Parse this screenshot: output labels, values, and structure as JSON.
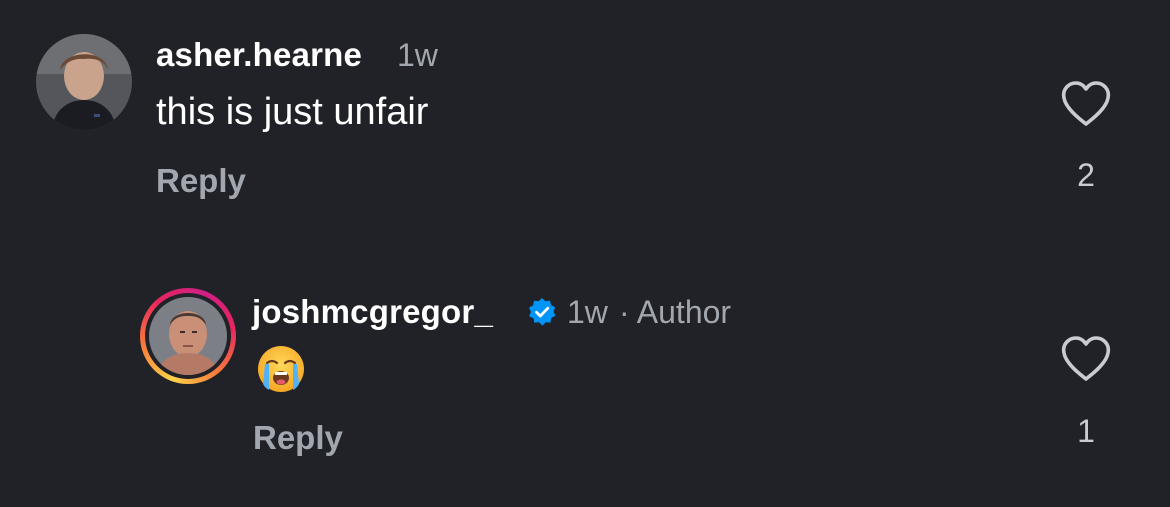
{
  "comments": [
    {
      "username": "asher.hearne",
      "time": "1w",
      "text": "this is just unfair",
      "reply_label": "Reply",
      "likes": "2",
      "verified": false,
      "is_author": false
    },
    {
      "username": "joshmcgregor_",
      "time": "1w",
      "author_label": "· Author",
      "text_emoji": "loudly-crying-face",
      "reply_label": "Reply",
      "likes": "1",
      "verified": true,
      "is_author": true,
      "has_story_ring": true
    }
  ],
  "colors": {
    "background": "#212227",
    "primary_text": "#ffffff",
    "secondary_text": "#a2a6ae",
    "verified_badge": "#0095f6"
  }
}
